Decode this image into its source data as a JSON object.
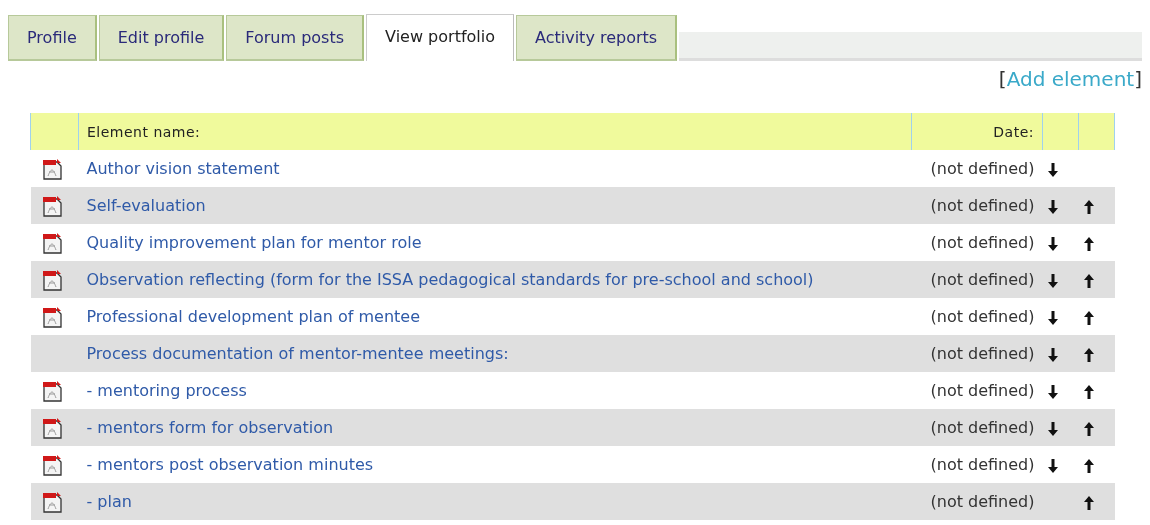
{
  "tabs": [
    {
      "label": "Profile",
      "selected": false
    },
    {
      "label": "Edit profile",
      "selected": false
    },
    {
      "label": "Forum posts",
      "selected": false
    },
    {
      "label": "View portfolio",
      "selected": true
    },
    {
      "label": "Activity reports",
      "selected": false
    }
  ],
  "add_link": {
    "open": "[",
    "label": "Add element",
    "close": "]"
  },
  "table": {
    "columns": [
      "Element name:",
      "Date:"
    ],
    "rows": [
      {
        "name": "Author vision statement",
        "date": "(not defined)",
        "file_icon": true,
        "move_down": true,
        "move_up": false
      },
      {
        "name": "Self-evaluation",
        "date": "(not defined)",
        "file_icon": true,
        "move_down": true,
        "move_up": true
      },
      {
        "name": "Quality improvement plan for mentor role",
        "date": "(not defined)",
        "file_icon": true,
        "move_down": true,
        "move_up": true
      },
      {
        "name": "Observation reflecting (form for the ISSA pedagogical standards for pre-school and school)",
        "date": "(not defined)",
        "file_icon": true,
        "move_down": true,
        "move_up": true
      },
      {
        "name": "Professional development plan of mentee",
        "date": "(not defined)",
        "file_icon": true,
        "move_down": true,
        "move_up": true
      },
      {
        "name": "Process documentation of mentor-mentee meetings:",
        "date": "(not defined)",
        "file_icon": false,
        "move_down": true,
        "move_up": true
      },
      {
        "name": "- mentoring process",
        "date": "(not defined)",
        "file_icon": true,
        "move_down": true,
        "move_up": true
      },
      {
        "name": "- mentors form for observation",
        "date": "(not defined)",
        "file_icon": true,
        "move_down": true,
        "move_up": true
      },
      {
        "name": "- mentors post observation minutes",
        "date": "(not defined)",
        "file_icon": true,
        "move_down": true,
        "move_up": true
      },
      {
        "name": "- plan",
        "date": "(not defined)",
        "file_icon": true,
        "move_down": false,
        "move_up": true
      }
    ]
  }
}
